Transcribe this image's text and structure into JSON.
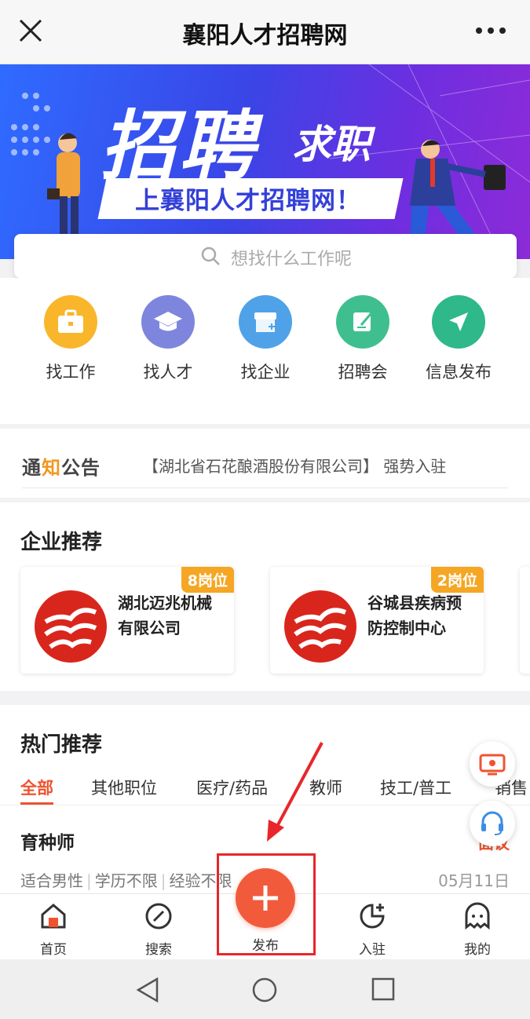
{
  "titlebar": {
    "title": "襄阳人才招聘网"
  },
  "banner": {
    "headline": "招聘",
    "headline_small": "求职",
    "ribbon": "上襄阳人才招聘网！"
  },
  "search": {
    "placeholder": "想找什么工作呢"
  },
  "quick_links": [
    {
      "label": "找工作",
      "icon": "briefcase-icon",
      "color": "#f9b62b"
    },
    {
      "label": "找人才",
      "icon": "graduation-cap-icon",
      "color": "#7d86dc"
    },
    {
      "label": "找企业",
      "icon": "store-icon",
      "color": "#4fa2e8"
    },
    {
      "label": "招聘会",
      "icon": "edit-icon",
      "color": "#3fbf8f"
    },
    {
      "label": "信息发布",
      "icon": "send-icon",
      "color": "#2fb889"
    }
  ],
  "notice": {
    "logo_a": "通",
    "logo_b": "知",
    "logo_c": "公",
    "logo_d": "告",
    "message": "【湖北省石花酿酒股份有限公司】 强势入驻"
  },
  "company_section": {
    "title": "企业推荐",
    "cards": [
      {
        "badge": "8岗位",
        "name": "湖北迈兆机械有限公司"
      },
      {
        "badge": "2岗位",
        "name": "谷城县疾病预防控制中心"
      }
    ]
  },
  "hot_section": {
    "title": "热门推荐",
    "tabs": [
      "全部",
      "其他职位",
      "医疗/药品",
      "教师",
      "技工/普工",
      "销售"
    ],
    "job": {
      "title": "育种师",
      "salary": "面议",
      "tags": [
        "适合男性",
        "学历不限",
        "经验不限"
      ],
      "date": "05月11日"
    }
  },
  "tabbar": {
    "home": "首页",
    "search": "搜索",
    "publish": "发布",
    "join": "入驻",
    "mine": "我的"
  },
  "colors": {
    "accent": "#f0532f",
    "annotation": "#e8262a"
  }
}
